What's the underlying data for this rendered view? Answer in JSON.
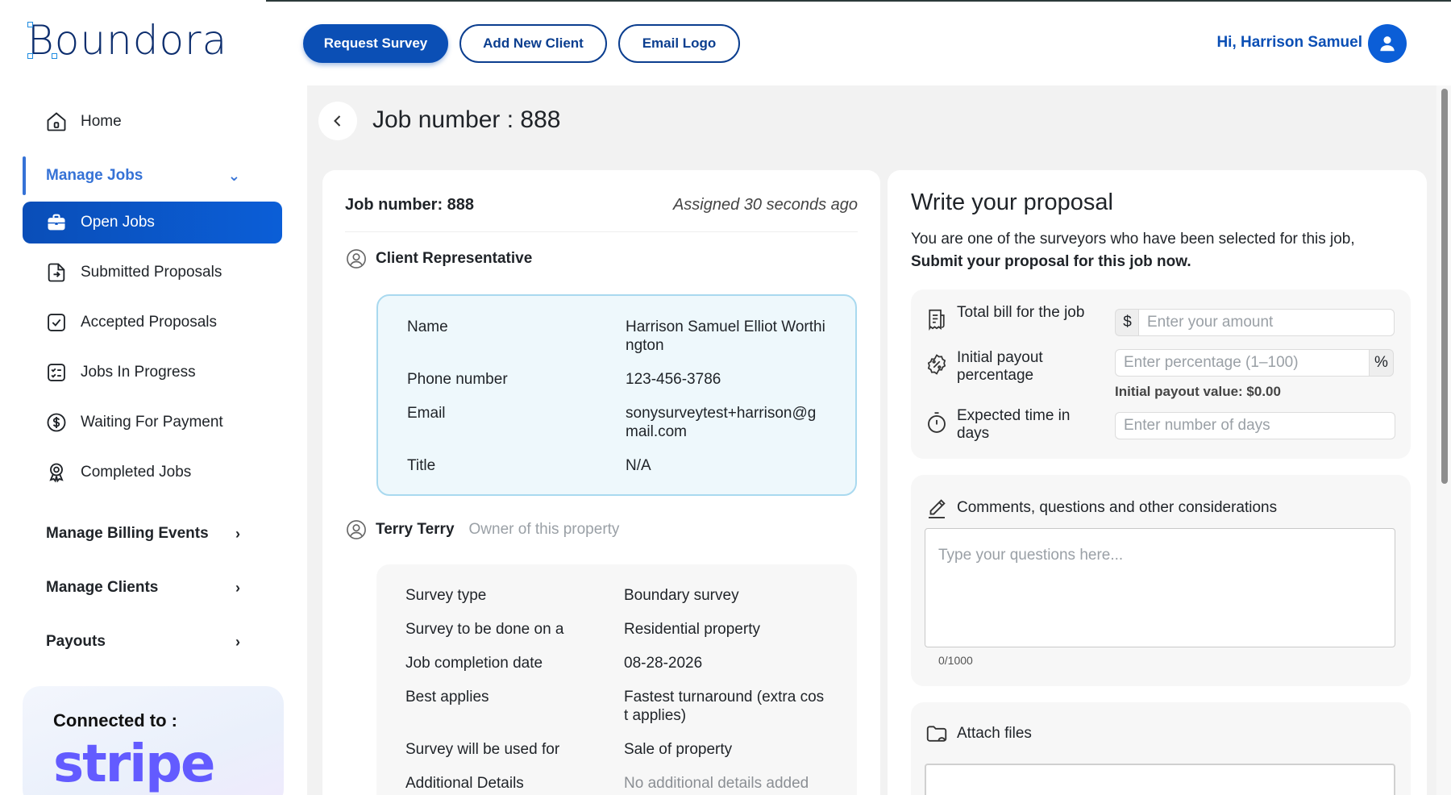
{
  "brand": {
    "name": "Boundora"
  },
  "sidebar": {
    "home": "Home",
    "manage_jobs": "Manage Jobs",
    "items": [
      {
        "label": "Open Jobs",
        "icon": "briefcase-icon"
      },
      {
        "label": "Submitted Proposals",
        "icon": "document-send-icon"
      },
      {
        "label": "Accepted Proposals",
        "icon": "check-square-icon"
      },
      {
        "label": "Jobs In Progress",
        "icon": "checklist-icon"
      },
      {
        "label": "Waiting For Payment",
        "icon": "dollar-circle-icon"
      },
      {
        "label": "Completed Jobs",
        "icon": "award-icon"
      }
    ],
    "groups": [
      {
        "label": "Manage Billing Events"
      },
      {
        "label": "Manage Clients"
      },
      {
        "label": "Payouts"
      }
    ],
    "connected_label": "Connected to :",
    "connected_service": "stripe"
  },
  "topbar": {
    "request_survey": "Request Survey",
    "add_new_client": "Add New Client",
    "email_logo": "Email Logo",
    "greeting": "Hi, Harrison Samuel"
  },
  "page": {
    "title": "Job number : 888"
  },
  "job": {
    "header": "Job number: 888",
    "assigned": "Assigned 30 seconds ago",
    "client_rep_title": "Client Representative",
    "client_rep": [
      {
        "k": "Name",
        "v": "Harrison Samuel Elliot Worthington"
      },
      {
        "k": "Phone number",
        "v": "123-456-3786"
      },
      {
        "k": "Email",
        "v": "sonysurveytest+harrison@gmail.com"
      },
      {
        "k": "Title",
        "v": "N/A"
      }
    ],
    "owner_name": "Terry Terry",
    "owner_sub": "Owner of this property",
    "details": [
      {
        "k": "Survey type",
        "v": "Boundary survey"
      },
      {
        "k": "Survey to be done on a",
        "v": "Residential property"
      },
      {
        "k": "Job completion date",
        "v": "08-28-2026"
      },
      {
        "k": "Best applies",
        "v": "Fastest turnaround (extra cost applies)"
      },
      {
        "k": "Survey will be used for",
        "v": "Sale of property"
      },
      {
        "k": "Additional Details",
        "v": "No additional details added"
      }
    ]
  },
  "proposal": {
    "title": "Write your proposal",
    "intro": "You are one of the surveyors who have been selected for this job,",
    "intro_bold": "Submit your proposal for this job now.",
    "total_bill_label": "Total bill for the job",
    "currency": "$",
    "amount_placeholder": "Enter your amount",
    "payout_label": "Initial payout percentage",
    "percent_placeholder": "Enter percentage (1–100)",
    "percent_symbol": "%",
    "payout_value": "Initial payout value: $0.00",
    "time_label": "Expected time in days",
    "days_placeholder": "Enter number of days",
    "comments_title": "Comments, questions and other considerations",
    "comments_placeholder": "Type your questions here...",
    "counter": "0/1000",
    "attach_title": "Attach files"
  },
  "colors": {
    "primary": "#0b4fb5",
    "accent": "#3572d6",
    "stripe": "#635bff",
    "info_box_border": "#a9d9ef"
  }
}
